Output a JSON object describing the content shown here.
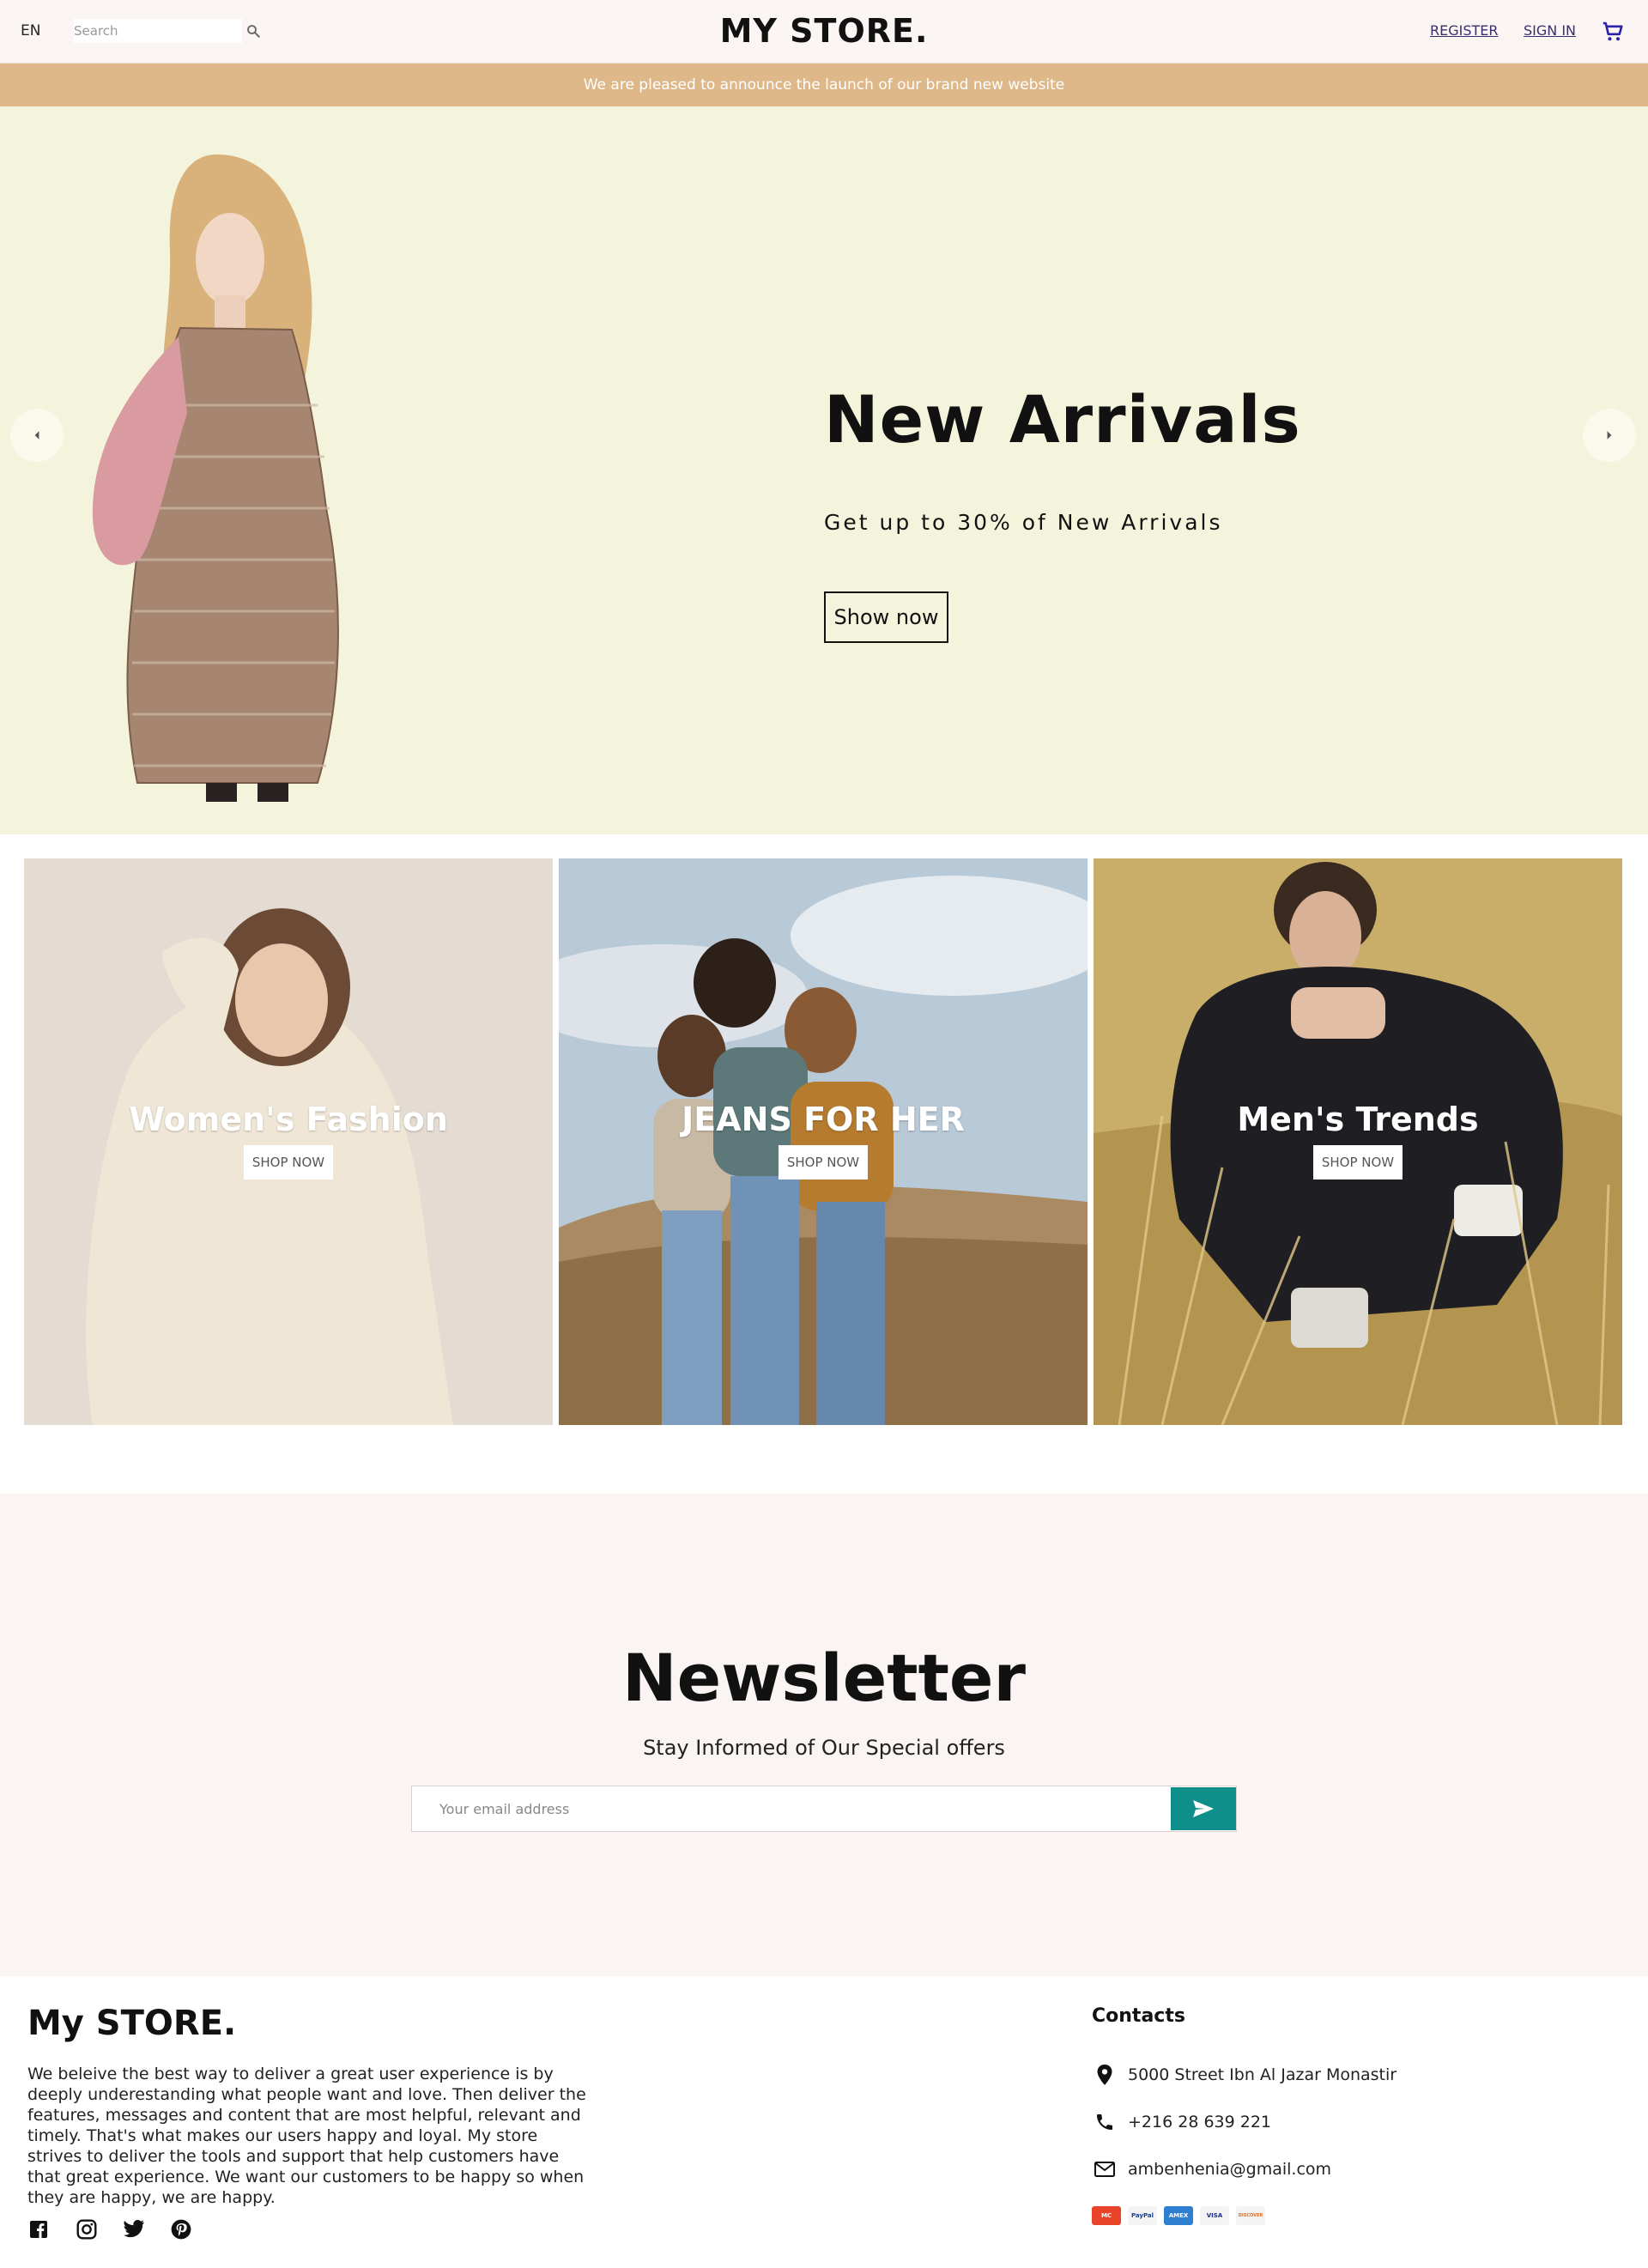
{
  "header": {
    "language": "EN",
    "search_placeholder": "Search",
    "logo": "MY STORE.",
    "register": "REGISTER",
    "sign_in": "SIGN IN"
  },
  "announcement": "We are pleased to announce the launch of our brand new website",
  "hero": {
    "title": "New Arrivals",
    "subtitle": "Get up to 30% of New Arrivals",
    "button": "Show now"
  },
  "categories": [
    {
      "title": "Women's Fashion",
      "button": "SHOP NOW"
    },
    {
      "title": "JEANS FOR HER",
      "button": "SHOP NOW"
    },
    {
      "title": "Men's Trends",
      "button": "SHOP NOW"
    }
  ],
  "newsletter": {
    "title": "Newsletter",
    "subtitle": "Stay Informed of Our Special offers",
    "email_placeholder": "Your email address"
  },
  "footer": {
    "logo": "My STORE.",
    "about": "We beleive the best way to deliver a great user experience is by deeply underestanding what people want and love. Then deliver the features, messages and content that are most helpful, relevant and timely. That's what makes our users happy and loyal. My store strives to deliver the tools and support that help customers have that great experience. We want our customers to be happy so when they are happy, we are happy.",
    "contacts_title": "Contacts",
    "address": "5000 Street Ibn Al Jazar Monastir",
    "phone": "+216 28 639 221",
    "email": "ambenhenia@gmail.com",
    "payments": [
      {
        "name": "mastercard-icon",
        "label": "MC",
        "bg": "#e9442a",
        "fg": "#ffffff"
      },
      {
        "name": "paypal-icon",
        "label": "PayPal",
        "bg": "#f4f4f4",
        "fg": "#1a3f8f"
      },
      {
        "name": "amex-icon",
        "label": "AMEX",
        "bg": "#2f7fd0",
        "fg": "#ffffff"
      },
      {
        "name": "visa-icon",
        "label": "VISA",
        "bg": "#f4f4f4",
        "fg": "#1a2c8f"
      },
      {
        "name": "discover-icon",
        "label": "DISCOVER",
        "bg": "#f4f4f4",
        "fg": "#e36a16"
      }
    ]
  },
  "colors": {
    "header_bg": "#fbf5f4",
    "announce_bg": "#dfb88a",
    "hero_bg": "#f4f3dc",
    "newsletter_bg": "#faf4f3",
    "send_button": "#0e8f89"
  }
}
